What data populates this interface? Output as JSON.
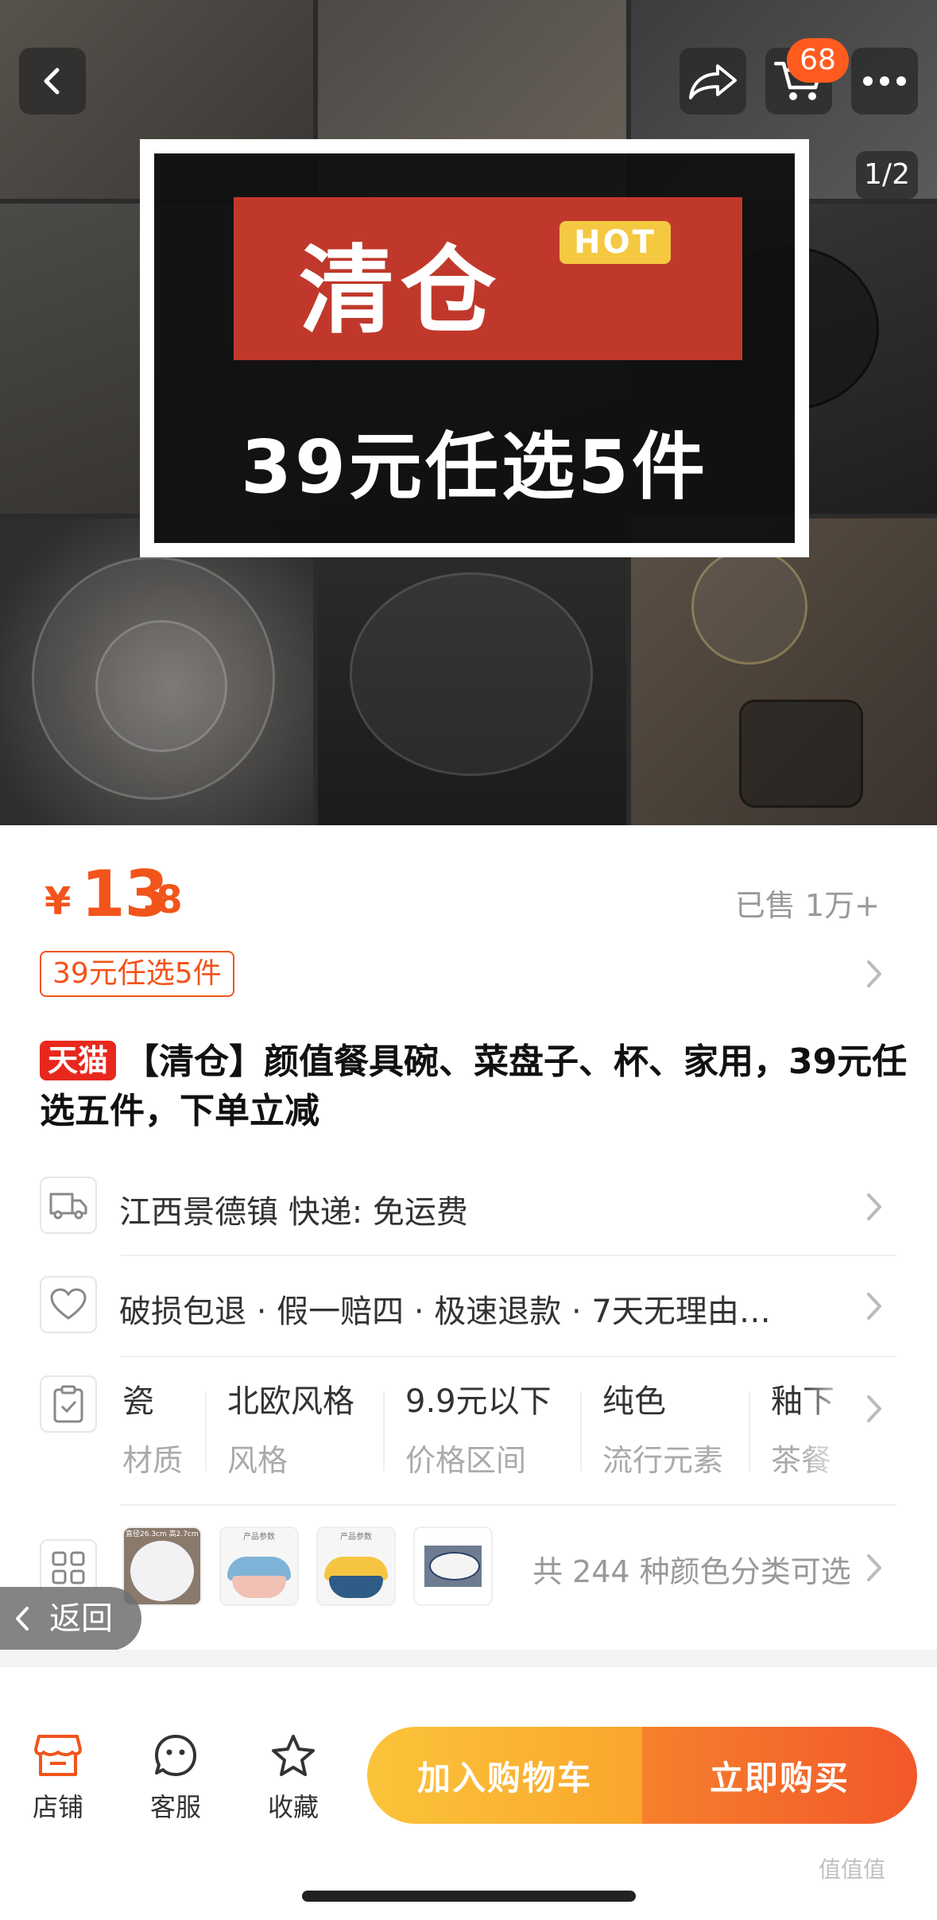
{
  "hero": {
    "promo_title": "清仓",
    "promo_hot": "HOT",
    "promo_line": "39元任选5件",
    "page_indicator": "1/2",
    "cart_count": "68"
  },
  "product": {
    "currency": "¥",
    "price_int": "13",
    "price_dec": ".8",
    "sold": "已售 1万+",
    "promo_tag": "39元任选5件",
    "tmall_badge": "天猫",
    "title": "【清仓】颜值餐具碗、菜盘子、杯、家用，39元任选五件，下单立减"
  },
  "shipping": {
    "text": "江西景德镇  快递: 免运费"
  },
  "service": {
    "text": "破损包退 · 假一赔四 · 极速退款 · 7天无理由…"
  },
  "attributes": [
    {
      "value": "瓷",
      "key": "材质"
    },
    {
      "value": "北欧风格",
      "key": "风格"
    },
    {
      "value": "9.9元以下",
      "key": "价格区间"
    },
    {
      "value": "纯色",
      "key": "流行元素"
    },
    {
      "value": "釉下",
      "key": "茶餐"
    }
  ],
  "variants": {
    "summary": "共 244 种颜色分类可选",
    "thumb_labels": [
      "直径26.3cm 高2.7cm",
      "产品参数",
      "产品参数",
      ""
    ]
  },
  "back_pill": {
    "label": "返回"
  },
  "bottom_bar": {
    "tabs": [
      {
        "label": "店铺",
        "icon": "store-icon"
      },
      {
        "label": "客服",
        "icon": "customer-service-icon"
      },
      {
        "label": "收藏",
        "icon": "star-icon"
      }
    ],
    "add_to_cart": "加入购物车",
    "buy_now": "立即购买"
  },
  "watermark": "值值值",
  "colors": {
    "accent": "#f2541b",
    "tmall": "#e8281e",
    "cart_cta": "#f9a62c",
    "buy_cta": "#f2582a"
  }
}
